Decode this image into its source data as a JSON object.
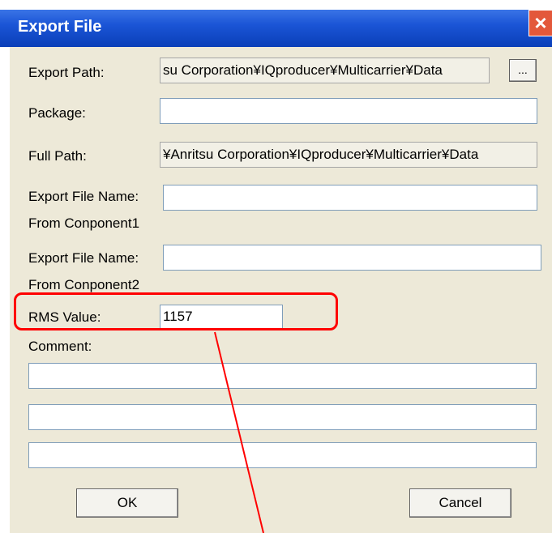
{
  "dialog": {
    "title": "Export File",
    "close_glyph": "×"
  },
  "form": {
    "export_path_label": "Export Path:",
    "export_path_value": "su Corporation¥IQproducer¥Multicarrier¥Data",
    "browse_label": "...",
    "package_label": "Package:",
    "package_value": "",
    "full_path_label": "Full Path:",
    "full_path_value": "¥Anritsu Corporation¥IQproducer¥Multicarrier¥Data",
    "export_file_name_label_1": "Export File Name:",
    "export_file_name_value_1": "",
    "from_component_1": "From Conponent1",
    "export_file_name_label_2": "Export File Name:",
    "export_file_name_value_2": "",
    "from_component_2": "From Conponent2",
    "rms_label": "RMS Value:",
    "rms_value": "1157",
    "comment_label": "Comment:",
    "comment_lines": [
      "",
      "",
      ""
    ]
  },
  "buttons": {
    "ok": "OK",
    "cancel": "Cancel"
  },
  "annotation": {
    "highlight_color": "#ff0000"
  }
}
